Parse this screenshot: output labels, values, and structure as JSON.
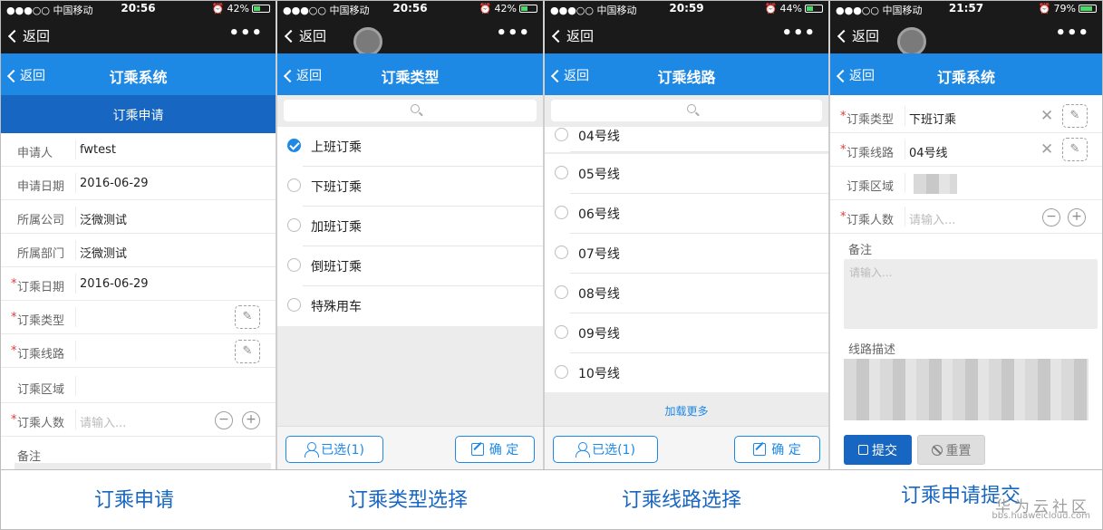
{
  "colors": {
    "blue": "#1e88e5",
    "dark_blue": "#1766c2",
    "status_bg": "#1a1a1a",
    "required": "#e53935"
  },
  "screens": [
    {
      "status": {
        "carrier": "●●●○○ 中国移动",
        "time": "20:56",
        "battery": "42%",
        "battery_level": 0.42
      },
      "nav": {
        "back": "返回",
        "more": "•••"
      },
      "title": {
        "back": "返回",
        "text": "订乘系统"
      },
      "subtitle": "订乘申请",
      "rows": [
        {
          "label": "申请人",
          "value": "fwtest"
        },
        {
          "label": "申请日期",
          "value": "2016-06-29"
        },
        {
          "label": "所属公司",
          "value": "泛微测试"
        },
        {
          "label": "所属部门",
          "value": "泛微测试"
        },
        {
          "label": "订乘日期",
          "value": "2016-06-29",
          "required": "*"
        },
        {
          "label": "订乘类型",
          "value": "",
          "required": "*"
        },
        {
          "label": "订乘线路",
          "value": "",
          "required": "*"
        },
        {
          "label": "订乘区域",
          "value": ""
        },
        {
          "label": "订乘人数",
          "placeholder": "请输入...",
          "required": "*"
        },
        {
          "label": "备注"
        }
      ],
      "stepper": {
        "minus": "−",
        "plus": "+"
      },
      "pick_icon": "pencil-icon",
      "caption": "订乘申请"
    },
    {
      "status": {
        "carrier": "●●●○○ 中国移动",
        "time": "20:56",
        "battery": "42%",
        "battery_level": 0.42
      },
      "nav": {
        "back": "返回",
        "more": "•••"
      },
      "title": {
        "back": "返回",
        "text": "订乘类型"
      },
      "options": [
        {
          "label": "上班订乘",
          "checked": true
        },
        {
          "label": "下班订乘",
          "checked": false
        },
        {
          "label": "加班订乘",
          "checked": false
        },
        {
          "label": "倒班订乘",
          "checked": false
        },
        {
          "label": "特殊用车",
          "checked": false
        }
      ],
      "selected_button": "已选(1)",
      "confirm_button": "确 定",
      "caption": "订乘类型选择"
    },
    {
      "status": {
        "carrier": "●●●○○ 中国移动",
        "time": "20:59",
        "battery": "44%",
        "battery_level": 0.44
      },
      "nav": {
        "back": "返回",
        "more": "•••"
      },
      "title": {
        "back": "返回",
        "text": "订乘线路"
      },
      "options": [
        {
          "label": "04号线"
        },
        {
          "label": "05号线"
        },
        {
          "label": "06号线"
        },
        {
          "label": "07号线"
        },
        {
          "label": "08号线"
        },
        {
          "label": "09号线"
        },
        {
          "label": "10号线"
        }
      ],
      "load_more": "加载更多",
      "selected_button": "已选(1)",
      "confirm_button": "确 定",
      "caption": "订乘线路选择"
    },
    {
      "status": {
        "carrier": "●●●○○ 中国移动",
        "time": "21:57",
        "battery": "79%",
        "battery_level": 0.79
      },
      "nav": {
        "back": "返回",
        "more": "•••"
      },
      "title": {
        "back": "返回",
        "text": "订乘系统"
      },
      "rows": [
        {
          "label": "订乘类型",
          "value": "下班订乘",
          "required": "*"
        },
        {
          "label": "订乘线路",
          "value": "04号线",
          "required": "*"
        },
        {
          "label": "订乘区域",
          "value": ""
        },
        {
          "label": "订乘人数",
          "placeholder": "请输入...",
          "required": "*"
        }
      ],
      "clear": "✕",
      "note_label": "备注",
      "note_placeholder": "请输入...",
      "route_desc_label": "线路描述",
      "submit_button": "提交",
      "reset_button": "重置",
      "caption": "订乘申请提交"
    }
  ],
  "watermark": {
    "line1": "华为云社区",
    "line2": "bbs.huaweicloud.com"
  }
}
